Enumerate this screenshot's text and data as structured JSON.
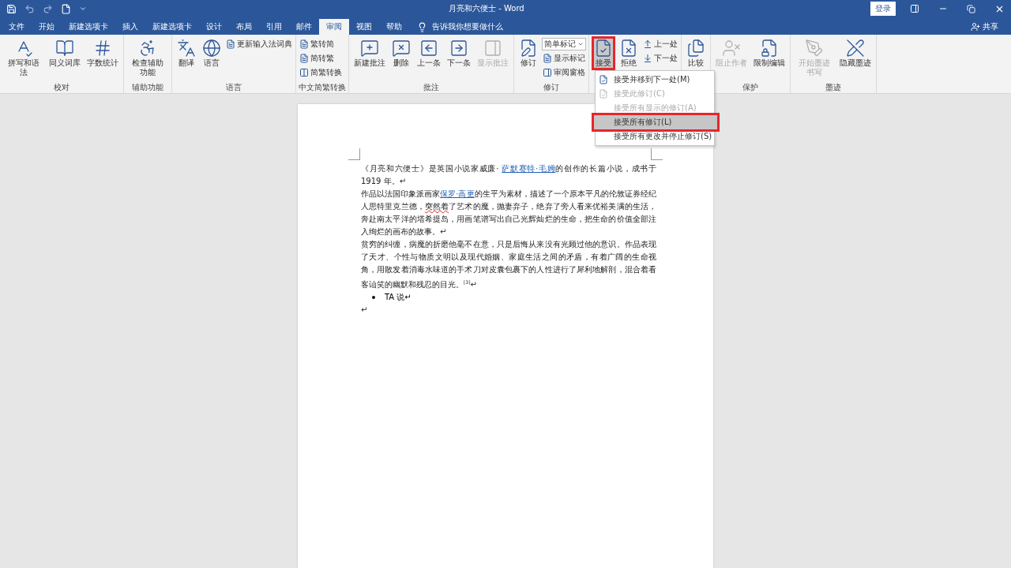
{
  "window": {
    "title": "月亮和六便士 - Word",
    "sign_in": "登录",
    "share": "共享"
  },
  "tabs": [
    {
      "label": "文件",
      "selected": false
    },
    {
      "label": "开始",
      "selected": false
    },
    {
      "label": "新建选项卡",
      "selected": false
    },
    {
      "label": "插入",
      "selected": false
    },
    {
      "label": "新建选项卡",
      "selected": false
    },
    {
      "label": "设计",
      "selected": false
    },
    {
      "label": "布局",
      "selected": false
    },
    {
      "label": "引用",
      "selected": false
    },
    {
      "label": "邮件",
      "selected": false
    },
    {
      "label": "审阅",
      "selected": true
    },
    {
      "label": "视图",
      "selected": false
    },
    {
      "label": "帮助",
      "selected": false
    }
  ],
  "tell_me": "告诉我你想要做什么",
  "ribbon_groups": [
    {
      "label": "校对",
      "buttons": [
        {
          "label": "拼写和语法",
          "kind": "large",
          "disabled": false
        },
        {
          "label": "同义词库",
          "kind": "large",
          "disabled": false
        },
        {
          "label": "字数统计",
          "kind": "large",
          "disabled": false
        }
      ]
    },
    {
      "label": "辅助功能",
      "buttons": [
        {
          "label": "检查辅助功能",
          "kind": "large",
          "disabled": false
        }
      ]
    },
    {
      "label": "语言",
      "buttons": [
        {
          "label": "翻译",
          "kind": "large",
          "disabled": false
        },
        {
          "label": "语言",
          "kind": "large",
          "disabled": false
        },
        {
          "label": "更新输入法词典",
          "kind": "small",
          "disabled": false
        }
      ]
    },
    {
      "label": "中文简繁转换",
      "buttons": [
        {
          "label": "繁转简",
          "kind": "small",
          "disabled": false
        },
        {
          "label": "简转繁",
          "kind": "small",
          "disabled": false
        },
        {
          "label": "简繁转换",
          "kind": "small",
          "disabled": false
        }
      ]
    },
    {
      "label": "批注",
      "buttons": [
        {
          "label": "新建批注",
          "kind": "large",
          "disabled": false
        },
        {
          "label": "删除",
          "kind": "large",
          "disabled": false
        },
        {
          "label": "上一条",
          "kind": "large",
          "disabled": false
        },
        {
          "label": "下一条",
          "kind": "large",
          "disabled": false
        },
        {
          "label": "显示批注",
          "kind": "large",
          "disabled": true
        }
      ]
    },
    {
      "label": "修订",
      "buttons": [
        {
          "label": "修订",
          "kind": "large",
          "disabled": false
        },
        {
          "label": "简单标记",
          "kind": "select",
          "disabled": false
        },
        {
          "label": "显示标记",
          "kind": "small",
          "disabled": false
        },
        {
          "label": "审阅窗格",
          "kind": "small",
          "disabled": false
        }
      ]
    },
    {
      "buttons": [
        {
          "label": "接受",
          "kind": "large",
          "disabled": false,
          "selected": true
        },
        {
          "label": "拒绝",
          "kind": "large",
          "disabled": false
        },
        {
          "label": "上一处",
          "kind": "small",
          "disabled": false
        },
        {
          "label": "下一处",
          "kind": "small",
          "disabled": false
        }
      ]
    },
    {
      "buttons": [
        {
          "label": "比较",
          "kind": "large",
          "disabled": false
        }
      ]
    },
    {
      "label": "保护",
      "buttons": [
        {
          "label": "阻止作者",
          "kind": "large",
          "disabled": true
        },
        {
          "label": "限制编辑",
          "kind": "large",
          "disabled": false
        }
      ]
    },
    {
      "label": "墨迹",
      "buttons": [
        {
          "label": "开始墨迹书写",
          "kind": "large",
          "disabled": true
        },
        {
          "label": "隐藏墨迹",
          "kind": "large",
          "disabled": false
        }
      ]
    }
  ],
  "accept_menu": [
    {
      "label": "接受并移到下一处(M)",
      "disabled": false,
      "highlighted": false,
      "icon": true
    },
    {
      "label": "接受此修订(C)",
      "disabled": true,
      "highlighted": false,
      "icon": true
    },
    {
      "label": "接受所有显示的修订(A)",
      "disabled": true,
      "highlighted": false,
      "icon": false
    },
    {
      "label": "接受所有修订(L)",
      "disabled": false,
      "highlighted": true,
      "icon": false
    },
    {
      "label": "接受所有更改并停止修订(S)",
      "disabled": false,
      "highlighted": false,
      "icon": false
    }
  ],
  "document": {
    "paragraphs": [
      {
        "kind": "text",
        "segments": [
          {
            "kind": "plain",
            "text": "《月亮和六便士》是英国小说家威廉· "
          },
          {
            "kind": "link",
            "text": "萨默赛特·毛姆"
          },
          {
            "kind": "plain",
            "text": "的创作的长篇小说，成书于 1919 年。↵"
          }
        ]
      },
      {
        "kind": "text",
        "segments": [
          {
            "kind": "plain",
            "text": "作品以法国印象派画家"
          },
          {
            "kind": "link",
            "text": "保罗·高更"
          },
          {
            "kind": "plain",
            "text": "的生平为素材，描述了一个原本平凡的伦敦证券经纪人思特里克兰德，"
          },
          {
            "kind": "misspelled",
            "text": "突然着"
          },
          {
            "kind": "plain",
            "text": "了艺术的魔，抛妻弃子，绝弃了旁人看来优裕美满的生活，奔赴南太平洋的塔希提岛，用画笔谱写出自己光辉灿烂的生命，把生命的价值全部注入绚烂的画布的故事。↵"
          }
        ]
      },
      {
        "kind": "text",
        "segments": [
          {
            "kind": "plain",
            "text": "贫穷的纠缠，病魔的折磨他毫不在意，只是后悔从来没有光顾过他的意识。作品表现了天才、个性与物质文明以及现代婚姻、家庭生活之间的矛盾，有着广阔的生命视角，用散发着消毒水味道的手术刀对皮囊包裹下的人性进行了犀利地解剖，混合着看客讪笑的幽默和残忍的目光。"
          },
          {
            "kind": "sup",
            "text": "[3]"
          },
          {
            "kind": "plain",
            "text": "↵"
          }
        ]
      },
      {
        "kind": "bullet",
        "segments": [
          {
            "kind": "plain",
            "text": "TA 说↵"
          }
        ]
      },
      {
        "kind": "text",
        "segments": [
          {
            "kind": "plain",
            "text": "↵"
          }
        ]
      }
    ]
  }
}
